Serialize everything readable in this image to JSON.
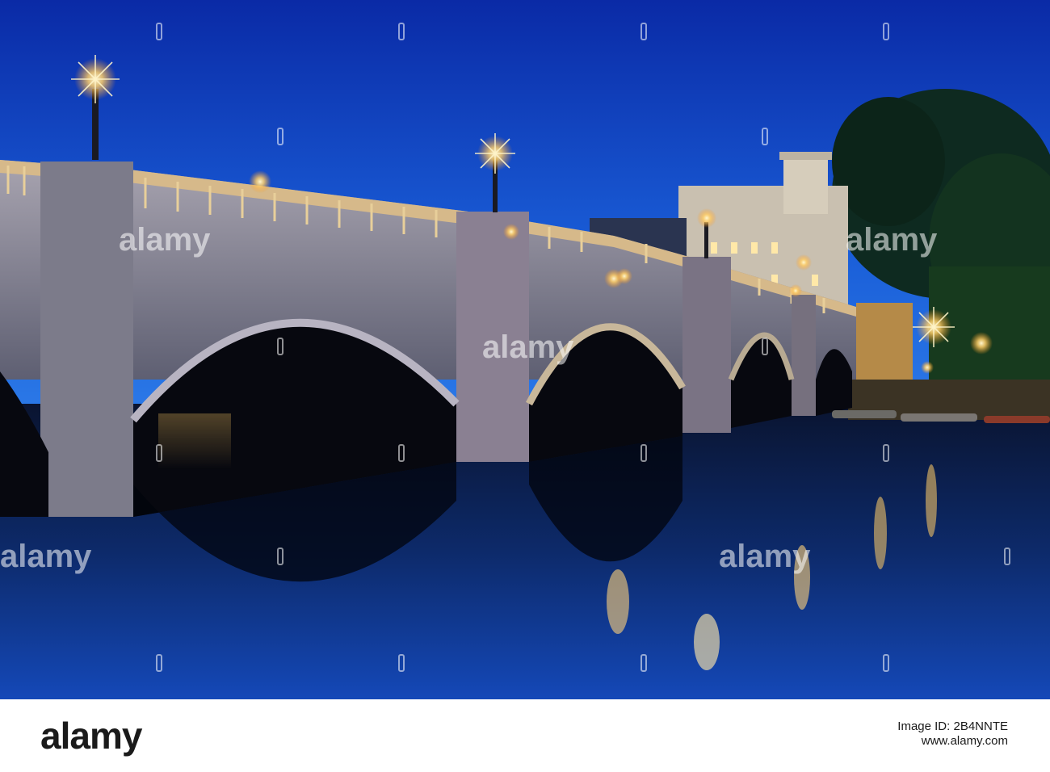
{
  "photo": {
    "subject": "stone arch bridge over river at dusk with lamps reflected in water",
    "colors": {
      "sky_top": "#0b2fb0",
      "sky_bottom": "#1f6fe0",
      "water_dark": "#050a1a",
      "lamp_glow": "#ffd27a",
      "stone": "#8a8a96"
    }
  },
  "watermark": {
    "text": "alamy",
    "icon": "alamy-watermark-mark"
  },
  "footer": {
    "logo": "alamy",
    "image_id_line1": "Image ID: 2B4NNTE",
    "image_id_line2": "www.alamy.com"
  }
}
